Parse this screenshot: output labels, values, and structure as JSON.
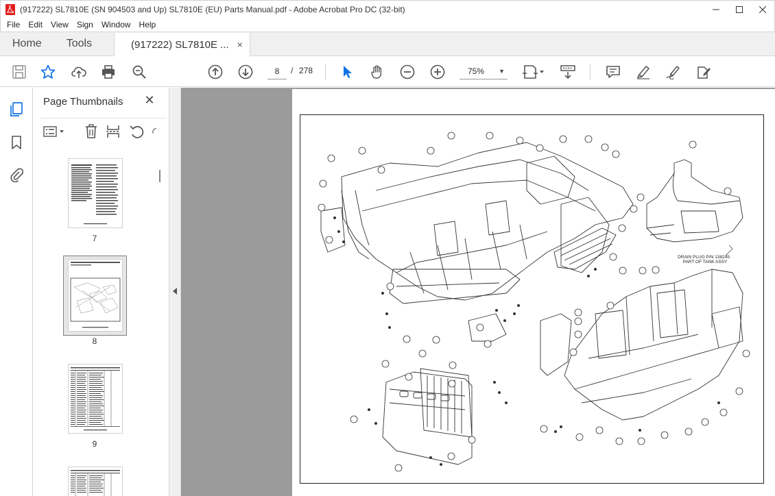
{
  "window": {
    "title": "(917222) SL7810E (SN 904503 and Up) SL7810E (EU) Parts Manual.pdf - Adobe Acrobat Pro DC (32-bit)",
    "app_icon": "acrobat-icon",
    "controls": [
      "minimize-icon",
      "maximize-icon",
      "close-icon"
    ]
  },
  "menu": [
    "File",
    "Edit",
    "View",
    "Sign",
    "Window",
    "Help"
  ],
  "tabs": {
    "home": "Home",
    "tools": "Tools",
    "document": "(917222) SL7810E ...",
    "document_close": "×"
  },
  "toolbar": {
    "current_page": "8",
    "page_separator": "/",
    "total_pages": "278",
    "zoom": "75%",
    "accent": "#1473e6"
  },
  "sidebar": {
    "title": "Page Thumbnails",
    "close": "✕",
    "thumbnails": [
      {
        "label": "7"
      },
      {
        "label": "8",
        "selected": true
      },
      {
        "label": "9"
      }
    ]
  },
  "diagram": {
    "drain_note_line1": "DRAIN PLUG P/N 138245",
    "drain_note_line2": "PART OF TANK ASSY"
  }
}
